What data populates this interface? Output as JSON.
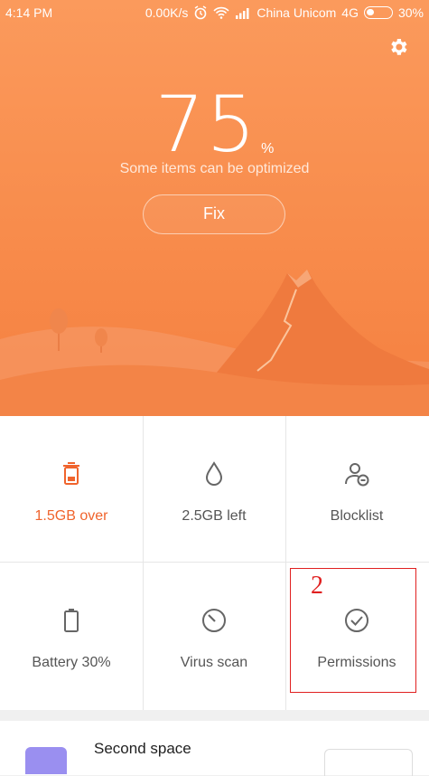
{
  "status_bar": {
    "time": "4:14 PM",
    "speed": "0.00K/s",
    "carrier": "China Unicom",
    "network": "4G",
    "battery_percent": "30%",
    "battery_level": 0.3
  },
  "hero": {
    "score": "75",
    "score_unit": "%",
    "subtitle": "Some items can be optimized",
    "fix_label": "Fix"
  },
  "tiles": [
    {
      "label": "1.5GB over",
      "icon": "trash-icon"
    },
    {
      "label": "2.5GB left",
      "icon": "droplet-icon"
    },
    {
      "label": "Blocklist",
      "icon": "user-block-icon"
    },
    {
      "label": "Battery 30%",
      "icon": "battery-icon"
    },
    {
      "label": "Virus scan",
      "icon": "scan-dial-icon"
    },
    {
      "label": "Permissions",
      "icon": "check-circle-icon"
    }
  ],
  "annotation": {
    "number": "2"
  },
  "second_space": {
    "title": "Second space"
  },
  "colors": {
    "accent": "#f0642d",
    "hero": "#f88c4c",
    "marker": "#e02020"
  }
}
